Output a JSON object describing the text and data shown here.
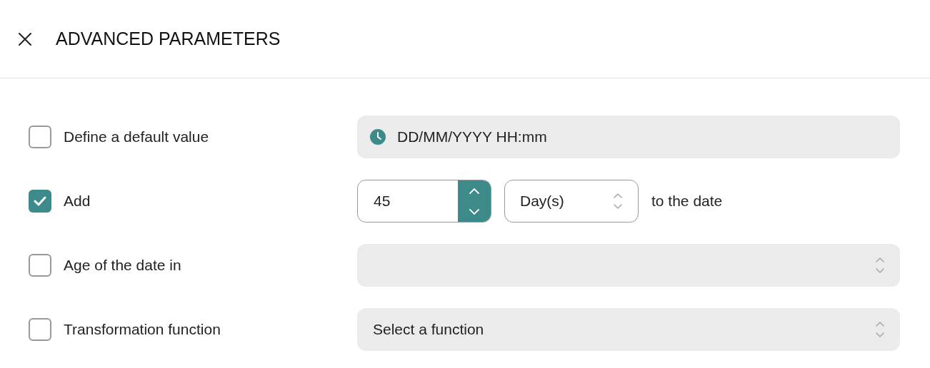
{
  "header": {
    "title": "ADVANCED PARAMETERS"
  },
  "rows": [
    {
      "kind": "datetime",
      "label": "Define a default value",
      "checked": false,
      "placeholder": "DD/MM/YYYY HH:mm"
    },
    {
      "kind": "offset",
      "label": "Add",
      "checked": true,
      "value": "45",
      "unit": "Day(s)",
      "suffix": "to the date"
    },
    {
      "kind": "select",
      "label": "Age of the date in",
      "checked": false
    },
    {
      "kind": "select",
      "label": "Transformation function",
      "checked": false,
      "placeholder": "Select a function"
    }
  ]
}
